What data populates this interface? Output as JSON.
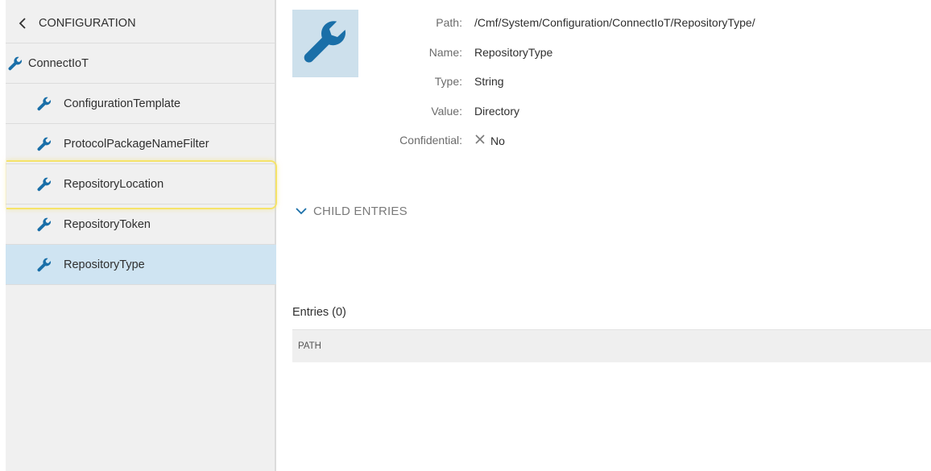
{
  "sidebar": {
    "back_label": "CONFIGURATION",
    "root_label": "ConnectIoT",
    "items": [
      {
        "label": "ConfigurationTemplate"
      },
      {
        "label": "ProtocolPackageNameFilter"
      },
      {
        "label": "RepositoryLocation"
      },
      {
        "label": "RepositoryToken"
      },
      {
        "label": "RepositoryType"
      }
    ]
  },
  "details": {
    "path_key": "Path:",
    "path_value": "/Cmf/System/Configuration/ConnectIoT/RepositoryType/",
    "name_key": "Name:",
    "name_value": "RepositoryType",
    "type_key": "Type:",
    "type_value": "String",
    "value_key": "Value:",
    "value_value": "Directory",
    "confidential_key": "Confidential:",
    "confidential_value": "No"
  },
  "child_entries": {
    "label": "CHILD ENTRIES",
    "entries_title": "Entries (0)",
    "column_path": "PATH"
  },
  "colors": {
    "accent": "#1a6fa8",
    "selected_bg": "#cfe4f2",
    "highlight": "#f5e36a",
    "tile_bg": "#cde0ec"
  },
  "icons": {
    "back": "chevron-left-icon",
    "wrench": "wrench-icon",
    "close": "x-icon",
    "expand": "chevron-down-icon"
  }
}
